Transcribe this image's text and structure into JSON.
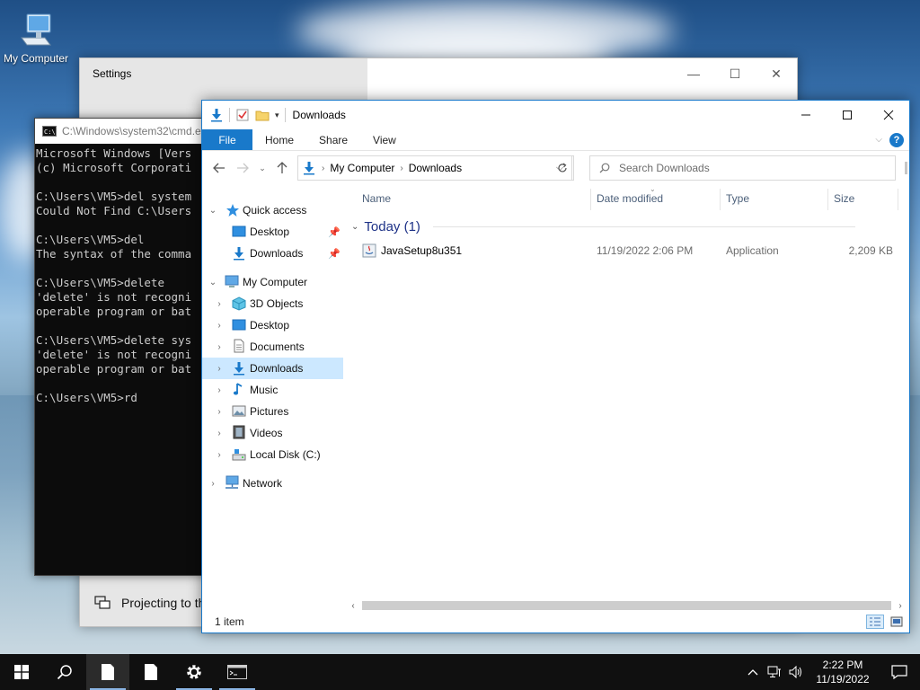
{
  "desktop": {
    "icon_label": "My Computer"
  },
  "settings": {
    "title": "Settings",
    "projecting_label": "Projecting to th",
    "minimize": "—",
    "maximize": "☐",
    "close": "✕"
  },
  "cmd": {
    "title": "C:\\Windows\\system32\\cmd.e",
    "lines": "Microsoft Windows [Vers\n(c) Microsoft Corporati\n\nC:\\Users\\VM5>del system\nCould Not Find C:\\Users\n\nC:\\Users\\VM5>del\nThe syntax of the comma\n\nC:\\Users\\VM5>delete\n'delete' is not recogni\noperable program or bat\n\nC:\\Users\\VM5>delete sys\n'delete' is not recogni\noperable program or bat\n\nC:\\Users\\VM5>rd"
  },
  "explorer": {
    "title": "Downloads",
    "ribbon": {
      "file": "File",
      "home": "Home",
      "share": "Share",
      "view": "View",
      "help": "?"
    },
    "address": {
      "crumbs": [
        "My Computer",
        "Downloads"
      ]
    },
    "search": {
      "placeholder": "Search Downloads"
    },
    "nav": {
      "quick_access": "Quick access",
      "qa_desktop": "Desktop",
      "qa_downloads": "Downloads",
      "my_computer": "My Computer",
      "objects3d": "3D Objects",
      "desktop": "Desktop",
      "documents": "Documents",
      "downloads": "Downloads",
      "music": "Music",
      "pictures": "Pictures",
      "videos": "Videos",
      "local_disk": "Local Disk (C:)",
      "network": "Network"
    },
    "columns": {
      "name": "Name",
      "date_modified": "Date modified",
      "type": "Type",
      "size": "Size"
    },
    "group": "Today (1)",
    "files": [
      {
        "name": "JavaSetup8u351",
        "date": "11/19/2022 2:06 PM",
        "type": "Application",
        "size": "2,209 KB"
      }
    ],
    "status": "1 item"
  },
  "taskbar": {
    "time": "2:22 PM",
    "date": "11/19/2022"
  },
  "colors": {
    "accent": "#1979ca",
    "selection": "#cce8ff",
    "group_header": "#1e3287"
  }
}
